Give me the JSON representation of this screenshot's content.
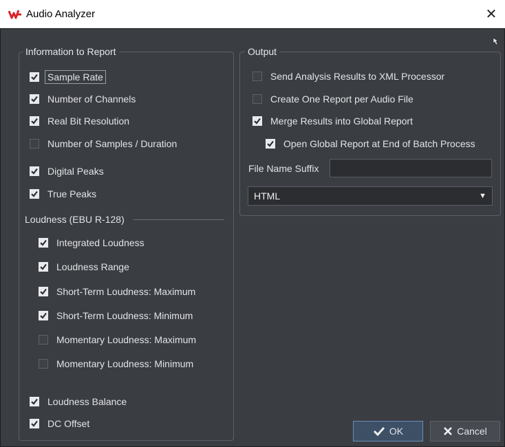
{
  "window": {
    "title": "Audio Analyzer",
    "close_glyph": "✕"
  },
  "info_group": {
    "title": "Information to Report",
    "items": [
      {
        "label": "Sample Rate",
        "checked": true
      },
      {
        "label": "Number of Channels",
        "checked": true
      },
      {
        "label": "Real Bit Resolution",
        "checked": true
      },
      {
        "label": "Number of Samples / Duration",
        "checked": false
      },
      {
        "label": "Digital Peaks",
        "checked": true
      },
      {
        "label": "True Peaks",
        "checked": true
      }
    ],
    "loudness_title": "Loudness (EBU R-128)",
    "loudness_items": [
      {
        "label": "Integrated Loudness",
        "checked": true
      },
      {
        "label": "Loudness Range",
        "checked": true
      },
      {
        "label": "Short-Term Loudness: Maximum",
        "checked": true
      },
      {
        "label": "Short-Term Loudness: Minimum",
        "checked": true
      },
      {
        "label": "Momentary Loudness: Maximum",
        "checked": false
      },
      {
        "label": "Momentary Loudness: Minimum",
        "checked": false
      }
    ],
    "extra_items": [
      {
        "label": "Loudness Balance",
        "checked": true
      },
      {
        "label": "DC Offset",
        "checked": true
      }
    ]
  },
  "output_group": {
    "title": "Output",
    "items": [
      {
        "label": "Send Analysis Results to XML Processor",
        "checked": false
      },
      {
        "label": "Create One Report per Audio File",
        "checked": false
      },
      {
        "label": "Merge Results into Global Report",
        "checked": true
      },
      {
        "label": "Open Global Report at End of Batch Process",
        "checked": true
      }
    ],
    "file_name_suffix_label": "File Name Suffix",
    "file_name_suffix_value": "",
    "format_selected": "HTML",
    "dropdown_glyph": "▼"
  },
  "buttons": {
    "ok_label": "OK",
    "cancel_label": "Cancel"
  },
  "colors": {
    "panel_bg": "#3a3d42",
    "text": "#e3e4e6",
    "ok_border": "#6b8fb8",
    "brand_red": "#d8232a"
  }
}
